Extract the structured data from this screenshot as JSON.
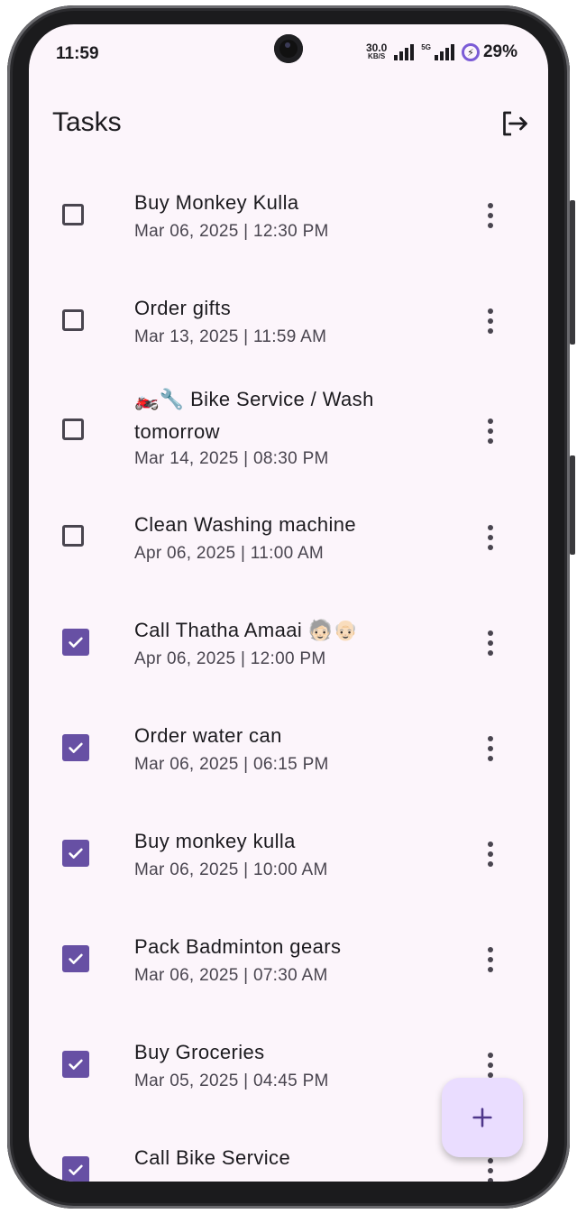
{
  "status_bar": {
    "time": "11:59",
    "net_speed_value": "30.0",
    "net_speed_unit": "KB/S",
    "network_label": "5G",
    "battery_percent": "29%"
  },
  "app_bar": {
    "title": "Tasks",
    "logout_icon": "logout-icon"
  },
  "tasks": [
    {
      "title": "Buy Monkey Kulla",
      "date": "Mar 06, 2025 | 12:30 PM",
      "done": false
    },
    {
      "title": "Order gifts",
      "date": "Mar 13, 2025 | 11:59 AM",
      "done": false
    },
    {
      "title": "🏍️🔧 Bike Service / Wash tomorrow",
      "date": "Mar 14, 2025 | 08:30 PM",
      "done": false
    },
    {
      "title": "Clean Washing machine",
      "date": "Apr 06, 2025 | 11:00 AM",
      "done": false
    },
    {
      "title": "Call Thatha Amaai 🧓🏻👴🏻",
      "date": "Apr 06, 2025 | 12:00 PM",
      "done": true
    },
    {
      "title": "Order water can",
      "date": "Mar 06, 2025 | 06:15 PM",
      "done": true
    },
    {
      "title": "Buy monkey kulla",
      "date": "Mar 06, 2025 | 10:00 AM",
      "done": true
    },
    {
      "title": "Pack Badminton gears",
      "date": "Mar 06, 2025 | 07:30 AM",
      "done": true
    },
    {
      "title": "Buy Groceries",
      "date": "Mar 05, 2025 | 04:45 PM",
      "done": true
    },
    {
      "title": "Call Bike Service",
      "date": "",
      "done": true
    }
  ],
  "fab": {
    "icon": "plus-icon"
  },
  "colors": {
    "background": "#fcf5fb",
    "checkbox_checked": "#6750a4",
    "fab_background": "#eaddff",
    "text_primary": "#1c1b1f",
    "text_secondary": "#49454f"
  }
}
